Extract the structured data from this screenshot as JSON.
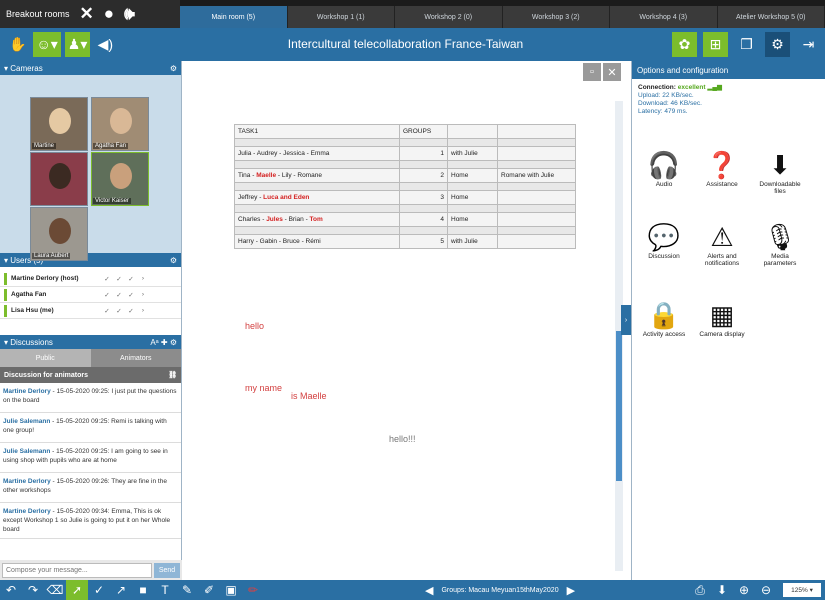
{
  "breakout": {
    "label": "Breakout rooms"
  },
  "tabs": [
    {
      "label": "Main room (5)"
    },
    {
      "label": "Workshop 1 (1)"
    },
    {
      "label": "Workshop 2 (0)"
    },
    {
      "label": "Workshop 3 (2)"
    },
    {
      "label": "Workshop 4 (3)"
    },
    {
      "label": "Atelier Workshop 5 (0)"
    }
  ],
  "toolbar": {
    "title": "Intercultural telecollaboration France-Taiwan"
  },
  "cameras": {
    "header": "Cameras",
    "tiles": [
      {
        "name": "Martine"
      },
      {
        "name": "Agatha Fan"
      },
      {
        "name": ""
      },
      {
        "name": "Victor Kaiser"
      },
      {
        "name": "Laura Aubert"
      }
    ]
  },
  "users": {
    "header": "Users (5)",
    "rows": [
      {
        "name": "Martine Derlory (host)"
      },
      {
        "name": "Agatha Fan"
      },
      {
        "name": "Lisa Hsu (me)"
      }
    ]
  },
  "discussions": {
    "header": "Discussions",
    "tab_public": "Public",
    "tab_animators": "Animators",
    "subheader": "Discussion for animators",
    "messages": [
      {
        "author": "Martine Derlory",
        "time": "15-05-2020 09:25",
        "text": "I just put the questions on the board"
      },
      {
        "author": "Julie Salemann",
        "time": "15-05-2020 09:25",
        "text": "Remi is talking with one group!"
      },
      {
        "author": "Julie Salemann",
        "time": "15-05-2020 09:25",
        "text": "I am going to see in using shop with pupils who are at home"
      },
      {
        "author": "Martine Derlory",
        "time": "15-05-2020 09:26",
        "text": "They are fine in the other workshops"
      },
      {
        "author": "Martine Derlory",
        "time": "15-05-2020 09:34",
        "text": "Emma, This is ok except Workshop 1 so Julie is going to put it on her Whole board"
      }
    ],
    "compose_placeholder": "Compose your message...",
    "send": "Send"
  },
  "board": {
    "table": {
      "header": [
        "TASK1",
        "GROUPS",
        "",
        ""
      ],
      "rows": [
        {
          "names": "Julia - Audrey - Jessica - Emma",
          "red": "",
          "after": "",
          "group": "1",
          "where": "with Julie",
          "note": ""
        },
        {
          "names": "Tina - ",
          "red": "Maelle",
          "after": " - Lily - Romane",
          "group": "2",
          "where": "Home",
          "note": "Romane with Julie"
        },
        {
          "names": "Jeffrey - ",
          "red": "Luca and Eden",
          "after": "",
          "group": "3",
          "where": "Home",
          "note": ""
        },
        {
          "names": "Charles - ",
          "red": "Jules",
          "after": " - Brian - ",
          "red2": "Tom",
          "group": "4",
          "where": "Home",
          "note": ""
        },
        {
          "names": "Harry - Gabin - Bruce - Rémi",
          "red": "",
          "after": "",
          "group": "5",
          "where": "with Julie",
          "note": ""
        }
      ]
    },
    "notes": {
      "hello": "hello",
      "myname": "my name",
      "ismaelle": "is Maelle",
      "hello2": "hello!!!"
    }
  },
  "options": {
    "header": "Options and configuration",
    "connection_label": "Connection:",
    "connection_value": "excellent",
    "upload": "Upload: 22 KB/sec.",
    "download": "Download: 46 KB/sec.",
    "latency": "Latency: 479 ms.",
    "items": [
      {
        "label": "Audio",
        "icon": "headphones-icon"
      },
      {
        "label": "Assistance",
        "icon": "help-icon"
      },
      {
        "label": "Downloadable files",
        "icon": "download-file-icon"
      },
      {
        "label": "Discussion",
        "icon": "chat-bubble-icon"
      },
      {
        "label": "Alerts and notifications",
        "icon": "alert-sound-icon"
      },
      {
        "label": "Media parameters",
        "icon": "media-params-icon"
      },
      {
        "label": "Activity access",
        "icon": "lock-users-icon"
      },
      {
        "label": "Camera display",
        "icon": "camera-grid-icon"
      }
    ]
  },
  "bottom": {
    "groups_label": "Groups: Macau Meyuan15thMay2020",
    "zoom": "125%"
  },
  "colors": {
    "accent": "#2a6fa3",
    "green": "#7cbd2c",
    "dark": "#1b1b1b",
    "red_text": "#d42121"
  }
}
